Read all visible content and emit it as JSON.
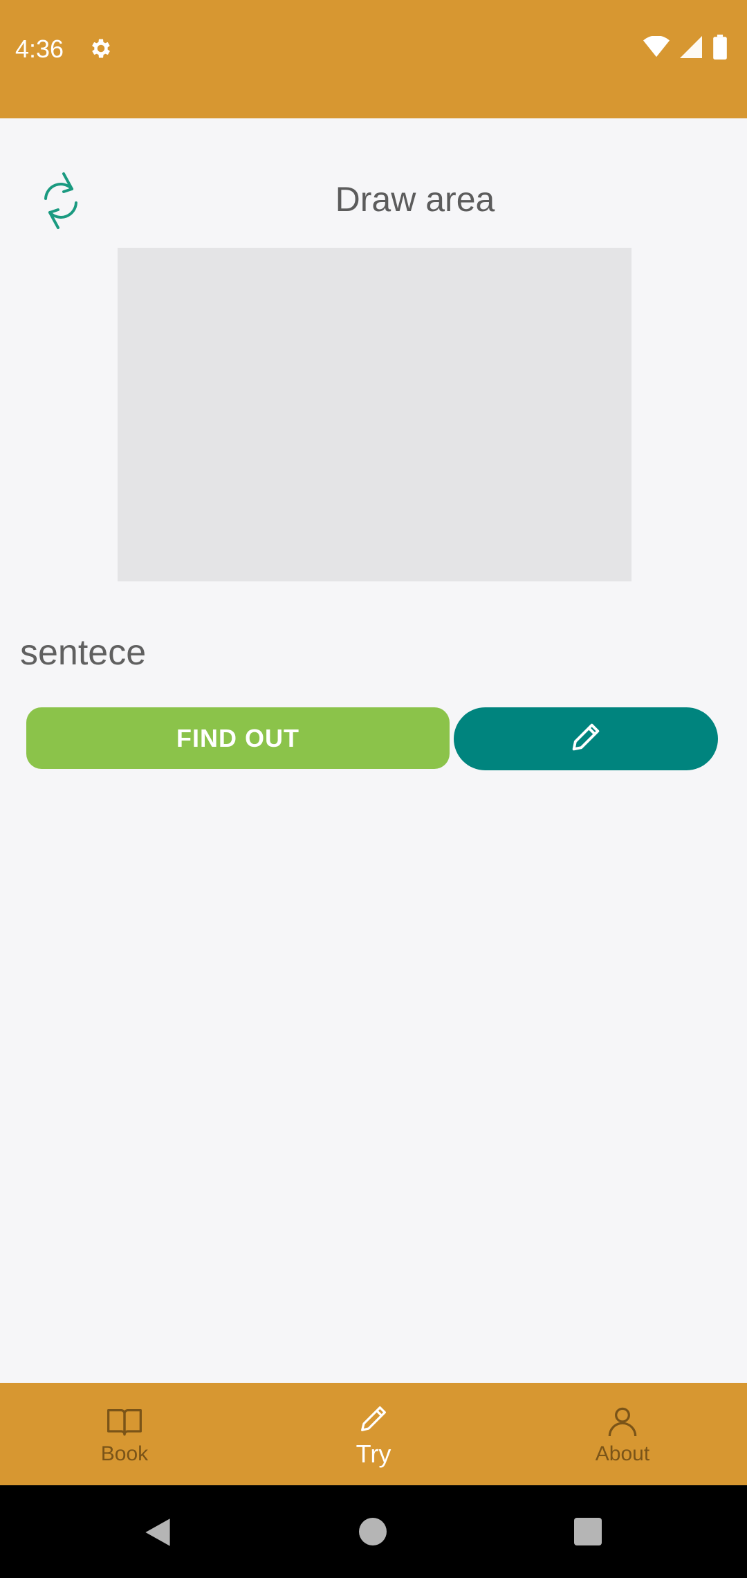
{
  "status_bar": {
    "time": "4:36",
    "icons": [
      "gear-icon",
      "wifi-icon",
      "signal-icon",
      "battery-icon"
    ]
  },
  "draw_section": {
    "title": "Draw area",
    "refresh_icon": "refresh-icon"
  },
  "sentence": {
    "text": "sentece"
  },
  "actions": {
    "find_out_label": "FIND OUT",
    "draw_icon": "pencil-icon"
  },
  "bottom_nav": {
    "items": [
      {
        "label": "Book",
        "icon": "book-icon",
        "active": false
      },
      {
        "label": "Try",
        "icon": "pencil-icon",
        "active": true
      },
      {
        "label": "About",
        "icon": "person-icon",
        "active": false
      }
    ]
  },
  "colors": {
    "bar": "#d79731",
    "find_out": "#8bc34a",
    "draw_button": "#00847e",
    "refresh_icon": "#1a9a80",
    "draw_area": "#e4e4e6"
  }
}
